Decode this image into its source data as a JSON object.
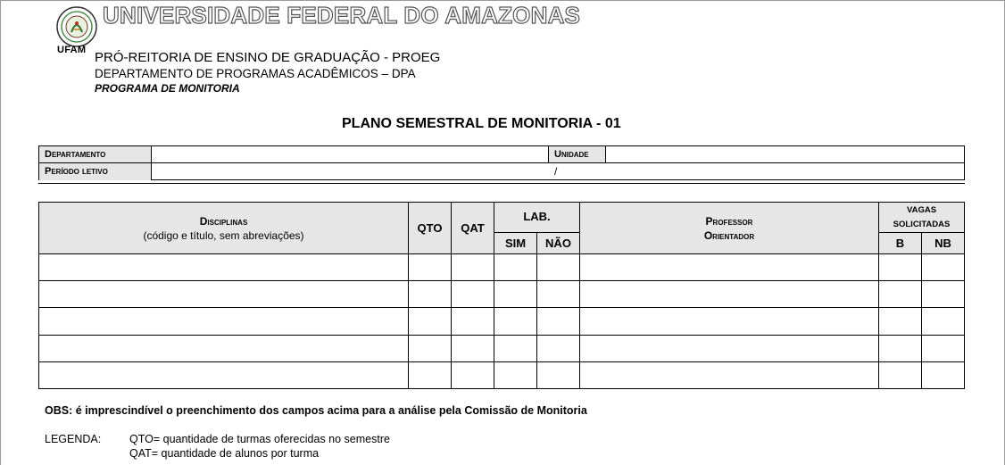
{
  "header": {
    "logo_caption": "UFAM",
    "university": "UNIVERSIDADE FEDERAL DO AMAZONAS",
    "proreitoria": "PRÓ-REITORIA DE ENSINO DE GRADUAÇÃO - PROEG",
    "departamento_line": "DEPARTAMENTO DE PROGRAMAS ACADÊMICOS – DPA",
    "programa": "PROGRAMA DE MONITORIA"
  },
  "form_title": "PLANO SEMESTRAL DE MONITORIA - 01",
  "info": {
    "departamento_label": "Departamento",
    "departamento_value": "",
    "unidade_label": "Unidade",
    "unidade_value": "",
    "periodo_label": "Período letivo",
    "periodo_value": "/"
  },
  "table": {
    "disciplinas_header": "Disciplinas",
    "disciplinas_sub": "(código e título, sem abreviações)",
    "qto_header": "QTO",
    "qat_header": "QAT",
    "lab_header": "LAB.",
    "sim_header": "SIM",
    "nao_header": "NÃO",
    "professor_header_1": "Professor",
    "professor_header_2": "Orientador",
    "vagas_header_1": "VAGAS",
    "vagas_header_2": "SOLICITADAS",
    "b_header": "B",
    "nb_header": "NB",
    "row_count": 5
  },
  "obs": "OBS: é imprescindível o preenchimento dos campos acima para a análise pela Comissão de Monitoria",
  "legenda": {
    "label": "LEGENDA:",
    "lines": [
      "QTO= quantidade de turmas oferecidas no semestre",
      "QAT=  quantidade de alunos por turma"
    ]
  }
}
